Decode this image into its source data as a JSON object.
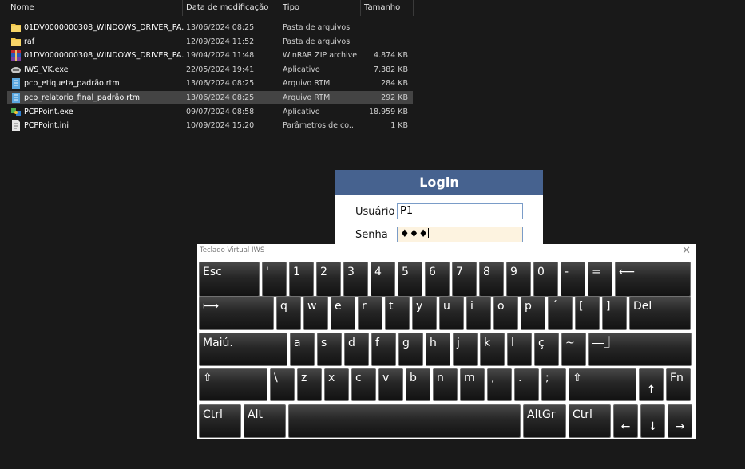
{
  "explorer": {
    "headers": {
      "name": "Nome",
      "date": "Data de modificação",
      "type": "Tipo",
      "size": "Tamanho"
    },
    "files": [
      {
        "name": "01DV0000000308_WINDOWS_DRIVER_PA...",
        "date": "13/06/2024 08:25",
        "type": "Pasta de arquivos",
        "size": "",
        "icon": "folder-icon",
        "selected": false
      },
      {
        "name": "raf",
        "date": "12/09/2024 11:52",
        "type": "Pasta de arquivos",
        "size": "",
        "icon": "folder-icon",
        "selected": false
      },
      {
        "name": "01DV0000000308_WINDOWS_DRIVER_PA...",
        "date": "19/04/2024 11:48",
        "type": "WinRAR ZIP archive",
        "size": "4.874 KB",
        "icon": "winrar-archive-icon",
        "selected": false
      },
      {
        "name": "IWS_VK.exe",
        "date": "22/05/2024 19:41",
        "type": "Aplicativo",
        "size": "7.382 KB",
        "icon": "keyboard-app-icon",
        "selected": false
      },
      {
        "name": "pcp_etiqueta_padrão.rtm",
        "date": "13/06/2024 08:25",
        "type": "Arquivo RTM",
        "size": "284 KB",
        "icon": "rtm-file-icon",
        "selected": false
      },
      {
        "name": "pcp_relatorio_final_padrão.rtm",
        "date": "13/06/2024 08:25",
        "type": "Arquivo RTM",
        "size": "292 KB",
        "icon": "rtm-file-icon",
        "selected": true
      },
      {
        "name": "PCPPoint.exe",
        "date": "09/07/2024 08:58",
        "type": "Aplicativo",
        "size": "18.959 KB",
        "icon": "pcppoint-app-icon",
        "selected": false
      },
      {
        "name": "PCPPoint.ini",
        "date": "10/09/2024 15:20",
        "type": "Parâmetros de co...",
        "size": "1 KB",
        "icon": "ini-file-icon",
        "selected": false
      }
    ]
  },
  "login": {
    "title": "Login",
    "user_label": "Usuário",
    "user_value": "P1",
    "password_label": "Senha",
    "password_value": "♦♦♦",
    "colors": {
      "title_bar": "#46628f",
      "password_bg": "#fdf3e0"
    }
  },
  "keyboard": {
    "title": "Teclado Virtual IWS",
    "close_glyph": "✕",
    "rows": [
      [
        {
          "l": "Esc",
          "w": 76
        },
        {
          "l": "'",
          "w": 31
        },
        {
          "l": "1",
          "w": 31
        },
        {
          "l": "2",
          "w": 31
        },
        {
          "l": "3",
          "w": 31
        },
        {
          "l": "4",
          "w": 31
        },
        {
          "l": "5",
          "w": 31
        },
        {
          "l": "6",
          "w": 31
        },
        {
          "l": "7",
          "w": 31
        },
        {
          "l": "8",
          "w": 31
        },
        {
          "l": "9",
          "w": 31
        },
        {
          "l": "0",
          "w": 31
        },
        {
          "l": "-",
          "w": 31
        },
        {
          "l": "=",
          "w": 31
        },
        {
          "l": "⟵",
          "w": 95
        }
      ],
      [
        {
          "l": "⟼",
          "w": 94
        },
        {
          "l": "q",
          "w": 31
        },
        {
          "l": "w",
          "w": 31
        },
        {
          "l": "e",
          "w": 31
        },
        {
          "l": "r",
          "w": 31
        },
        {
          "l": "t",
          "w": 31
        },
        {
          "l": "y",
          "w": 31
        },
        {
          "l": "u",
          "w": 31
        },
        {
          "l": "i",
          "w": 31
        },
        {
          "l": "o",
          "w": 31
        },
        {
          "l": "p",
          "w": 31
        },
        {
          "l": "´",
          "w": 31
        },
        {
          "l": "[",
          "w": 31
        },
        {
          "l": "]",
          "w": 31
        },
        {
          "l": "Del",
          "w": 77
        }
      ],
      [
        {
          "l": "Maiú.",
          "w": 111
        },
        {
          "l": "a",
          "w": 31
        },
        {
          "l": "s",
          "w": 31
        },
        {
          "l": "d",
          "w": 31
        },
        {
          "l": "f",
          "w": 31
        },
        {
          "l": "g",
          "w": 31
        },
        {
          "l": "h",
          "w": 31
        },
        {
          "l": "j",
          "w": 31
        },
        {
          "l": "k",
          "w": 31
        },
        {
          "l": "l",
          "w": 31
        },
        {
          "l": "ç",
          "w": 31
        },
        {
          "l": "~",
          "w": 31
        },
        {
          "l": "⎯⎯⏌",
          "w": 129
        }
      ],
      [
        {
          "l": "⇧",
          "w": 86
        },
        {
          "l": "\\",
          "w": 31
        },
        {
          "l": "z",
          "w": 31
        },
        {
          "l": "x",
          "w": 31
        },
        {
          "l": "c",
          "w": 31
        },
        {
          "l": "v",
          "w": 31
        },
        {
          "l": "b",
          "w": 31
        },
        {
          "l": "n",
          "w": 31
        },
        {
          "l": "m",
          "w": 31
        },
        {
          "l": ",",
          "w": 31
        },
        {
          "l": ".",
          "w": 31
        },
        {
          "l": ";",
          "w": 31
        },
        {
          "l": "⇧",
          "w": 85
        },
        {
          "l": "↑",
          "w": 31,
          "low": true
        },
        {
          "l": "Fn",
          "w": 31
        }
      ],
      [
        {
          "l": "Ctrl",
          "w": 53
        },
        {
          "l": "Alt",
          "w": 53
        },
        {
          "l": "",
          "w": 291
        },
        {
          "l": "AltGr",
          "w": 54
        },
        {
          "l": "Ctrl",
          "w": 53
        },
        {
          "l": "←",
          "w": 31,
          "low": true
        },
        {
          "l": "↓",
          "w": 31,
          "low": true
        },
        {
          "l": "→",
          "w": 31,
          "low": true
        }
      ]
    ],
    "key_names": [
      [
        "esc",
        "apostrophe",
        "1",
        "2",
        "3",
        "4",
        "5",
        "6",
        "7",
        "8",
        "9",
        "0",
        "minus",
        "equals",
        "backspace"
      ],
      [
        "tab",
        "q",
        "w",
        "e",
        "r",
        "t",
        "y",
        "u",
        "i",
        "o",
        "p",
        "acute",
        "bracket-left",
        "bracket-right",
        "del"
      ],
      [
        "caps-lock",
        "a",
        "s",
        "d",
        "f",
        "g",
        "h",
        "j",
        "k",
        "l",
        "c-cedilla",
        "tilde",
        "enter"
      ],
      [
        "shift-left",
        "backslash",
        "z",
        "x",
        "c",
        "v",
        "b",
        "n",
        "m",
        "comma",
        "period",
        "semicolon",
        "shift-right",
        "arrow-up",
        "fn"
      ],
      [
        "ctrl-left",
        "alt",
        "space",
        "altgr",
        "ctrl-right",
        "arrow-left",
        "arrow-down",
        "arrow-right"
      ]
    ]
  }
}
